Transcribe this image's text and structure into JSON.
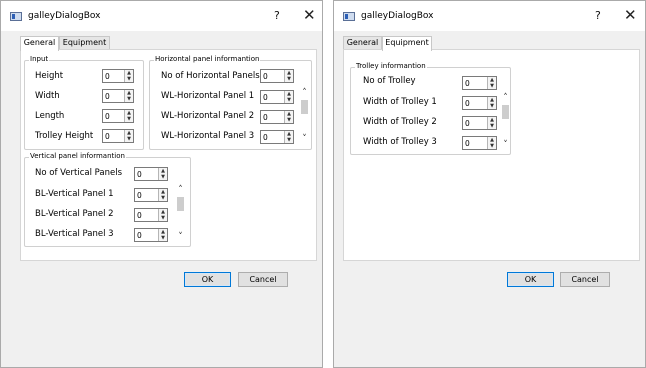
{
  "dialog_general": {
    "title": "galleyDialogBox",
    "help": "?",
    "close": "✕",
    "tabs": [
      "General",
      "Equipment"
    ],
    "active_tab": "General",
    "input_group": {
      "title": "Input",
      "fields": [
        {
          "label": "Height",
          "value": "0"
        },
        {
          "label": "Width",
          "value": "0"
        },
        {
          "label": "Length",
          "value": "0"
        },
        {
          "label": "Trolley Height",
          "value": "0"
        }
      ]
    },
    "horizontal_group": {
      "title": "Horizontal panel informantion",
      "fields": [
        {
          "label": "No of Horizontal Panels",
          "value": "0"
        },
        {
          "label": "WL-Horizontal Panel 1",
          "value": "0"
        },
        {
          "label": "WL-Horizontal Panel 2",
          "value": "0"
        },
        {
          "label": "WL-Horizontal Panel 3",
          "value": "0"
        }
      ]
    },
    "vertical_group": {
      "title": "Vertical panel informantion",
      "fields": [
        {
          "label": "No of Vertical Panels",
          "value": "0"
        },
        {
          "label": "BL-Vertical Panel 1",
          "value": "0"
        },
        {
          "label": "BL-Vertical Panel 2",
          "value": "0"
        },
        {
          "label": "BL-Vertical Panel 3",
          "value": "0"
        }
      ]
    },
    "ok": "OK",
    "cancel": "Cancel"
  },
  "dialog_equipment": {
    "title": "galleyDialogBox",
    "help": "?",
    "close": "✕",
    "tabs": [
      "General",
      "Equipment"
    ],
    "active_tab": "Equipment",
    "trolley_group": {
      "title": "Trolley informantion",
      "fields": [
        {
          "label": "No of Trolley",
          "value": "0"
        },
        {
          "label": "Width of Trolley 1",
          "value": "0"
        },
        {
          "label": "Width of Trolley 2",
          "value": "0"
        },
        {
          "label": "Width of Trolley 3",
          "value": "0"
        }
      ]
    },
    "ok": "OK",
    "cancel": "Cancel"
  },
  "icons": {
    "app": "app-window-icon",
    "spin_up": "▲",
    "spin_down": "▼",
    "scroll_up": "˄",
    "scroll_down": "˅"
  }
}
